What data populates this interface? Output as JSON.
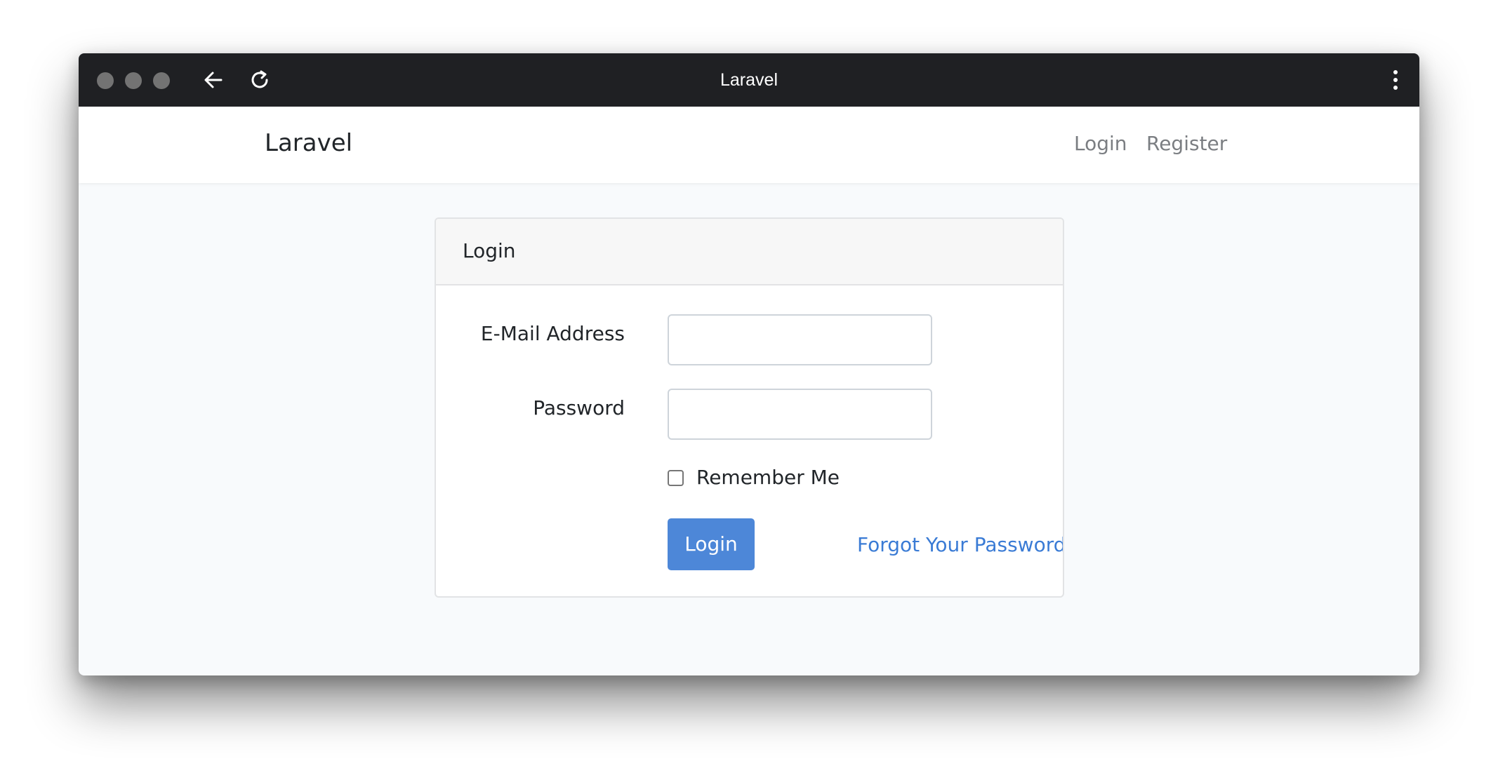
{
  "browser": {
    "title": "Laravel",
    "controls": {
      "traffic_lights": [
        "close",
        "minimize",
        "zoom"
      ],
      "back_icon": "arrow-left-icon",
      "reload_icon": "reload-icon",
      "menu_icon": "more-vertical-icon"
    }
  },
  "navbar": {
    "brand": "Laravel",
    "links": {
      "login": "Login",
      "register": "Register"
    }
  },
  "login_card": {
    "header": "Login",
    "email": {
      "label": "E-Mail Address",
      "value": "",
      "placeholder": ""
    },
    "password": {
      "label": "Password",
      "value": "",
      "placeholder": ""
    },
    "remember": {
      "label": "Remember Me",
      "checked": false
    },
    "submit_label": "Login",
    "forgot_label": "Forgot Your Password?"
  },
  "colors": {
    "titlebar": "#1f2023",
    "page_background": "#f8fafc",
    "primary_button": "#4d87d8",
    "link": "#3a7bd5",
    "nav_link": "#7b7e82"
  }
}
